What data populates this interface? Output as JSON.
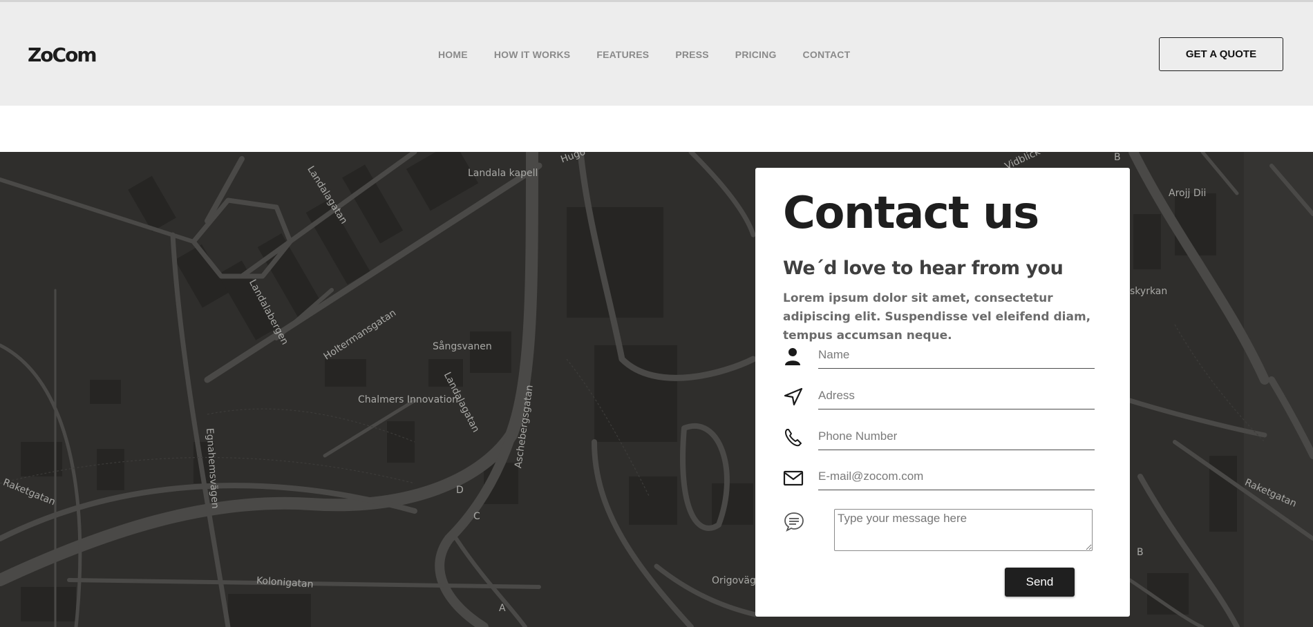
{
  "brand": {
    "logo": "ZoCom"
  },
  "nav": {
    "items": [
      "HOME",
      "HOW IT WORKS",
      "FEATURES",
      "PRESS",
      "PRICING",
      "CONTACT"
    ],
    "cta": "GET A QUOTE"
  },
  "map": {
    "labels": [
      "Landala kapell",
      "Landalagatan",
      "Landalabergen",
      "Holtermansgatan",
      "Sångsvanen",
      "Landalagatan",
      "Chalmers Innovation",
      "Aschebergsgatan",
      "Egnahemsvägen",
      "Raketgatan",
      "Kolonigatan",
      "Origovägen",
      "Arojj Dii",
      "skyrkan",
      "Raketgatan",
      "Hugo",
      "Vidblick",
      "D",
      "C",
      "A",
      "B",
      "B"
    ]
  },
  "contact": {
    "title": "Contact us",
    "subtitle": "We´d love to hear from you",
    "description": "Lorem ipsum dolor sit amet, consectetur adipiscing elit. Suspendisse vel eleifend diam, tempus accumsan neque.",
    "fields": {
      "name": {
        "placeholder": "Name",
        "icon": "person-icon"
      },
      "address": {
        "placeholder": "Adress",
        "icon": "location-arrow-icon"
      },
      "phone": {
        "placeholder": "Phone Number",
        "icon": "phone-icon"
      },
      "email": {
        "placeholder": "E-mail@zocom.com",
        "icon": "envelope-icon"
      }
    },
    "message": {
      "placeholder": "Type your message here",
      "icon": "chat-bubble-icon"
    },
    "send": "Send"
  },
  "colors": {
    "header_bg": "#ededed",
    "map_bg": "#2f2e2c",
    "map_road": "#4a4947",
    "button_dark": "#1f1f1f",
    "nav_text": "#8a8a8a"
  }
}
